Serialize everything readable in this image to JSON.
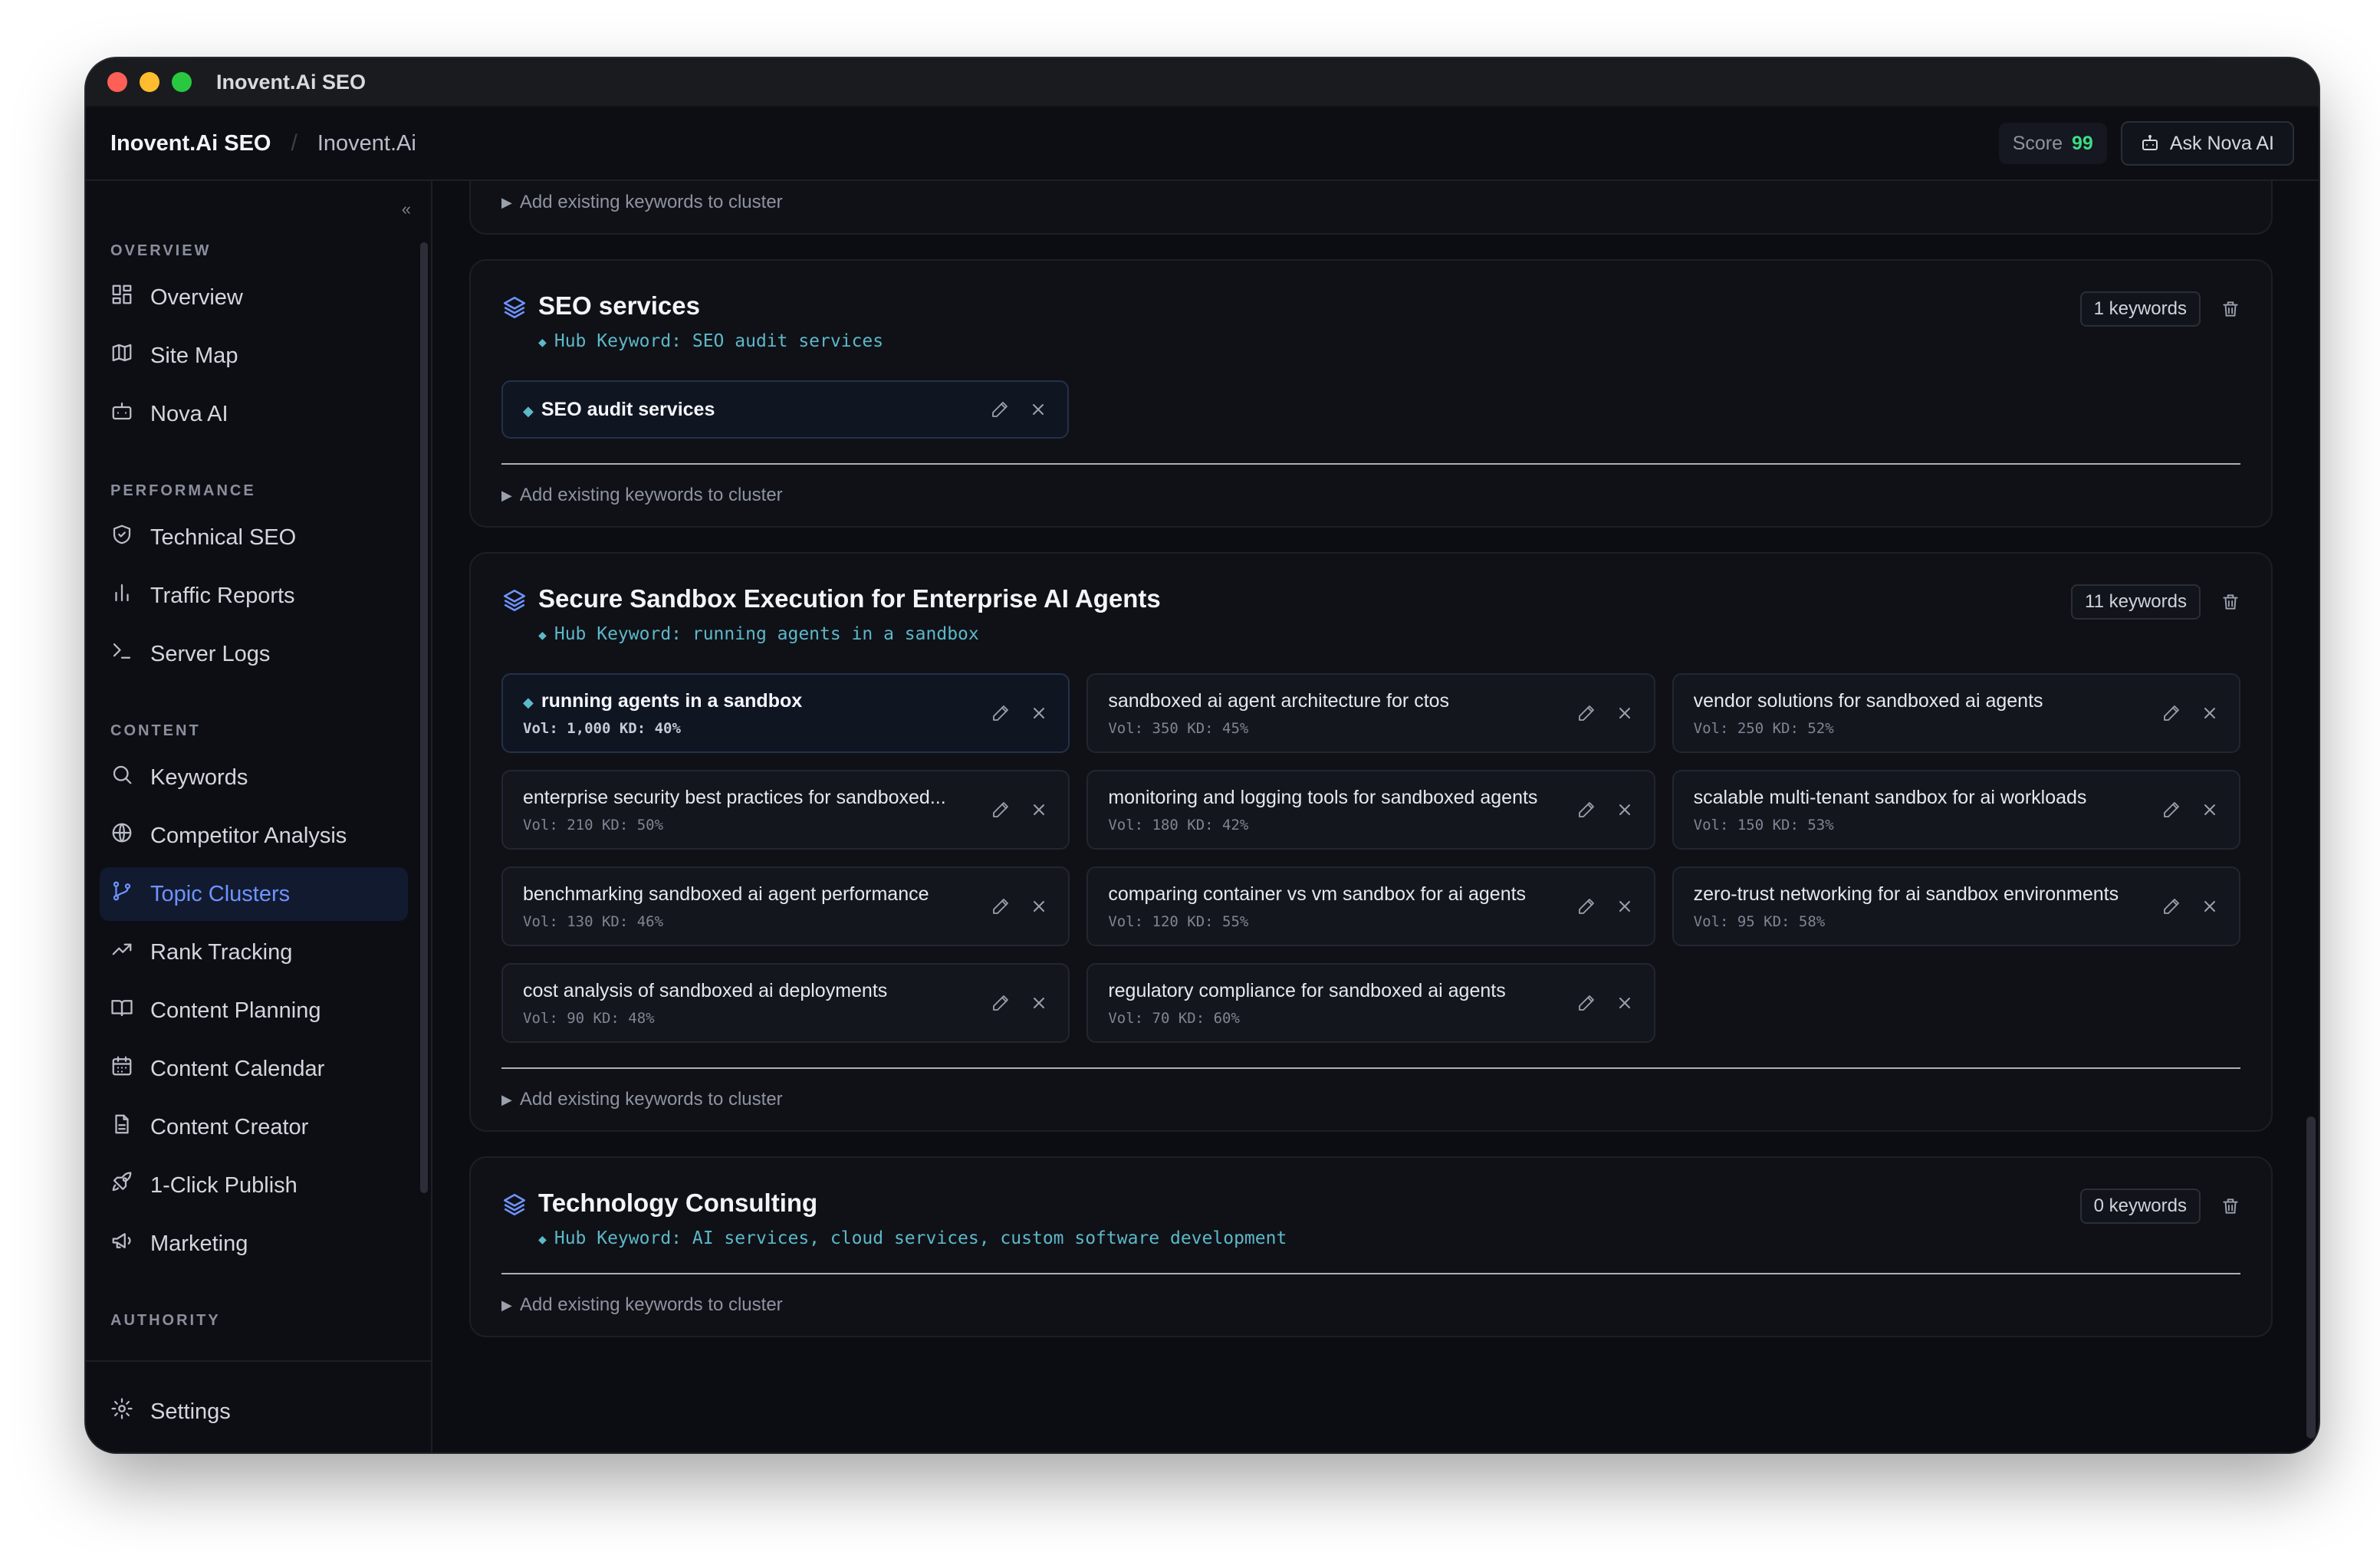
{
  "window": {
    "title": "Inovent.Ai SEO"
  },
  "header": {
    "app_name": "Inovent.Ai SEO",
    "crumb": "Inovent.Ai",
    "score_label": "Score",
    "score_value": "99",
    "ask_label": "Ask Nova AI"
  },
  "sidebar": {
    "collapse_glyph": "«",
    "sections": [
      {
        "label": "OVERVIEW",
        "items": [
          {
            "label": "Overview",
            "icon": "dashboard-icon"
          },
          {
            "label": "Site Map",
            "icon": "map-icon"
          },
          {
            "label": "Nova AI",
            "icon": "bot-icon"
          }
        ]
      },
      {
        "label": "PERFORMANCE",
        "items": [
          {
            "label": "Technical SEO",
            "icon": "shield-icon"
          },
          {
            "label": "Traffic Reports",
            "icon": "bar-chart-icon"
          },
          {
            "label": "Server Logs",
            "icon": "terminal-icon"
          }
        ]
      },
      {
        "label": "CONTENT",
        "items": [
          {
            "label": "Keywords",
            "icon": "search-icon"
          },
          {
            "label": "Competitor Analysis",
            "icon": "globe-icon"
          },
          {
            "label": "Topic Clusters",
            "icon": "git-branch-icon",
            "active": true
          },
          {
            "label": "Rank Tracking",
            "icon": "trending-up-icon"
          },
          {
            "label": "Content Planning",
            "icon": "book-icon"
          },
          {
            "label": "Content Calendar",
            "icon": "calendar-icon"
          },
          {
            "label": "Content Creator",
            "icon": "file-icon"
          },
          {
            "label": "1-Click Publish",
            "icon": "rocket-icon"
          },
          {
            "label": "Marketing",
            "icon": "megaphone-icon"
          }
        ]
      },
      {
        "label": "AUTHORITY",
        "items": []
      }
    ],
    "bottom_item": {
      "label": "Settings",
      "icon": "gear-icon"
    }
  },
  "main": {
    "add_existing_label": "Add existing keywords to cluster",
    "clusters": [
      {
        "title": "SEO services",
        "hub_label": "Hub Keyword: SEO audit services",
        "count_label": "1 keywords",
        "keywords": [
          {
            "name": "SEO audit services",
            "meta": "",
            "hub": true
          }
        ]
      },
      {
        "title": "Secure Sandbox Execution for Enterprise AI Agents",
        "hub_label": "Hub Keyword: running agents in a sandbox",
        "count_label": "11 keywords",
        "keywords": [
          {
            "name": "running agents in a sandbox",
            "meta": "Vol: 1,000  KD: 40%",
            "hub": true
          },
          {
            "name": "sandboxed ai agent architecture for ctos",
            "meta": "Vol: 350  KD: 45%"
          },
          {
            "name": "vendor solutions for sandboxed ai agents",
            "meta": "Vol: 250  KD: 52%"
          },
          {
            "name": "enterprise security best practices for sandboxed...",
            "meta": "Vol: 210  KD: 50%"
          },
          {
            "name": "monitoring and logging tools for sandboxed agents",
            "meta": "Vol: 180  KD: 42%"
          },
          {
            "name": "scalable multi-tenant sandbox for ai workloads",
            "meta": "Vol: 150  KD: 53%"
          },
          {
            "name": "benchmarking sandboxed ai agent performance",
            "meta": "Vol: 130  KD: 46%"
          },
          {
            "name": "comparing container vs vm sandbox for ai agents",
            "meta": "Vol: 120  KD: 55%"
          },
          {
            "name": "zero-trust networking for ai sandbox environments",
            "meta": "Vol: 95  KD: 58%"
          },
          {
            "name": "cost analysis of sandboxed ai deployments",
            "meta": "Vol: 90  KD: 48%"
          },
          {
            "name": "regulatory compliance for sandboxed ai agents",
            "meta": "Vol: 70  KD: 60%"
          }
        ]
      },
      {
        "title": "Technology Consulting",
        "hub_label": "Hub Keyword: AI services, cloud services, custom software development",
        "count_label": "0 keywords",
        "keywords": []
      }
    ]
  },
  "colors": {
    "accent": "#6e93ff",
    "hub": "#5db8c8",
    "score": "#3ddc84"
  }
}
